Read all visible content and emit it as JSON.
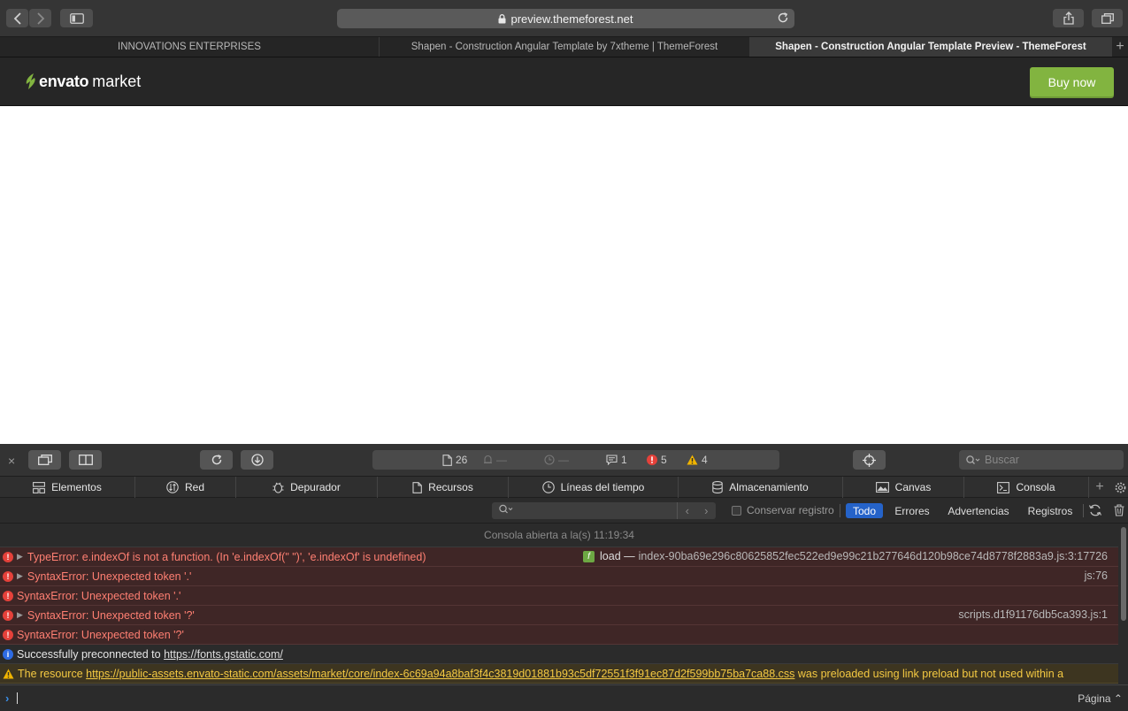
{
  "browser": {
    "url": "preview.themeforest.net",
    "tabs": [
      {
        "label": "INNOVATIONS ENTERPRISES"
      },
      {
        "label": "Shapen - Construction Angular Template by 7xtheme | ThemeForest"
      },
      {
        "label": "Shapen - Construction Angular Template Preview - ThemeForest"
      }
    ],
    "new_tab": "+"
  },
  "envato": {
    "brand": "envato",
    "market": "market",
    "buy_now": "Buy now",
    "accent": "#82b440"
  },
  "devtools": {
    "close": "×",
    "activity": {
      "resources": "26",
      "memory": "—",
      "time": "—",
      "logs": "1",
      "errors": "5",
      "warnings": "4"
    },
    "search_placeholder": "Buscar",
    "tabs": [
      {
        "label": "Elementos",
        "icon": "elements-icon"
      },
      {
        "label": "Red",
        "icon": "network-icon"
      },
      {
        "label": "Depurador",
        "icon": "debugger-icon"
      },
      {
        "label": "Recursos",
        "icon": "resources-icon"
      },
      {
        "label": "Líneas del tiempo",
        "icon": "timelines-icon"
      },
      {
        "label": "Almacenamiento",
        "icon": "storage-icon"
      },
      {
        "label": "Canvas",
        "icon": "canvas-icon"
      },
      {
        "label": "Consola",
        "icon": "console-icon"
      }
    ],
    "add_tab": "+",
    "filter": {
      "preserve_log": "Conservar registro",
      "levels": [
        "Todo",
        "Errores",
        "Advertencias",
        "Registros"
      ],
      "active_level": "Todo"
    },
    "console": {
      "opened": "Consola abierta a la(s) 11:19:34",
      "messages": [
        {
          "type": "error",
          "expandable": true,
          "text": "TypeError: e.indexOf is not a function. (In 'e.indexOf(\" \")', 'e.indexOf' is undefined)",
          "source_prefix": "load —",
          "source": "index-90ba69e296c80625852fec522ed9e99c21b277646d120b98ce74d8778f2883a9.js:3:17726"
        },
        {
          "type": "error",
          "expandable": true,
          "text": "SyntaxError: Unexpected token '.'",
          "source": "js:76"
        },
        {
          "type": "error",
          "expandable": false,
          "text": "SyntaxError: Unexpected token '.'",
          "source": ""
        },
        {
          "type": "error",
          "expandable": true,
          "text": "SyntaxError: Unexpected token '?'",
          "source": "scripts.d1f91176db5ca393.js:1"
        },
        {
          "type": "error",
          "expandable": false,
          "text": "SyntaxError: Unexpected token '?'",
          "source": ""
        },
        {
          "type": "info",
          "text": "Successfully preconnected to",
          "link": "https://fonts.gstatic.com/"
        },
        {
          "type": "warning",
          "text": "The resource",
          "link": "https://public-assets.envato-static.com/assets/market/core/index-6c69a94a8baf3f4c3819d01881b93c5df72551f3f91ec87d2f599bb75ba7ca88.css",
          "text_after": "was preloaded using link preload but not used within a"
        }
      ]
    },
    "context": "Página ⌃"
  }
}
